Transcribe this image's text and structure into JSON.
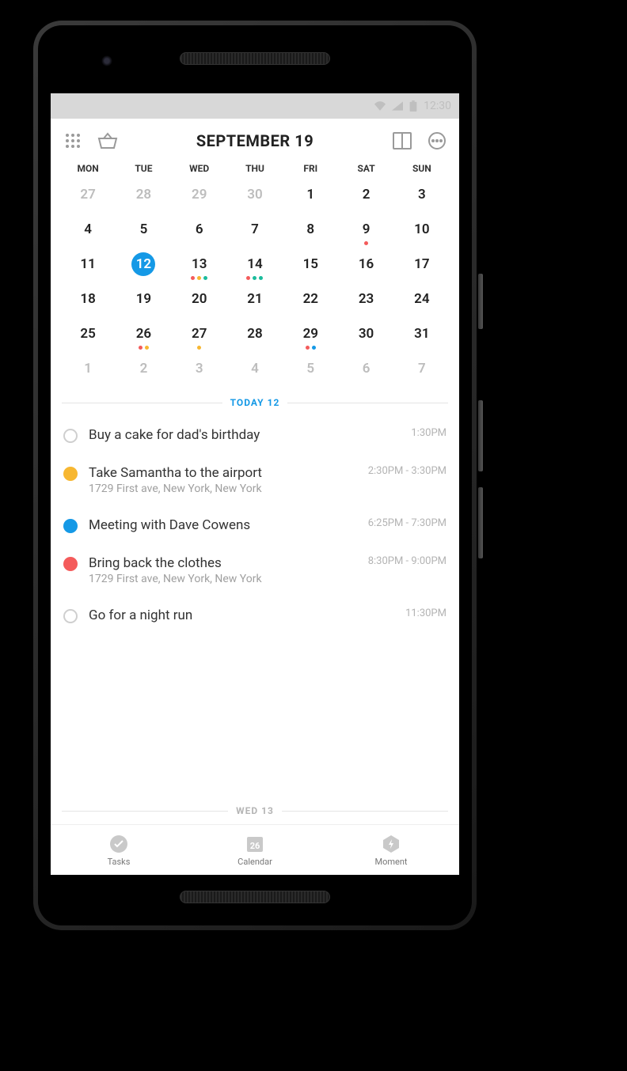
{
  "statusBar": {
    "time": "12:30"
  },
  "header": {
    "title": "SEPTEMBER 19"
  },
  "weekdays": [
    "MON",
    "TUE",
    "WED",
    "THU",
    "FRI",
    "SAT",
    "SUN"
  ],
  "calendar": {
    "selected": 12,
    "weeks": [
      [
        {
          "n": 27,
          "muted": true
        },
        {
          "n": 28,
          "muted": true
        },
        {
          "n": 29,
          "muted": true
        },
        {
          "n": 30,
          "muted": true
        },
        {
          "n": 1
        },
        {
          "n": 2
        },
        {
          "n": 3
        }
      ],
      [
        {
          "n": 4
        },
        {
          "n": 5
        },
        {
          "n": 6
        },
        {
          "n": 7
        },
        {
          "n": 8
        },
        {
          "n": 9,
          "dots": [
            "red"
          ]
        },
        {
          "n": 10
        }
      ],
      [
        {
          "n": 11
        },
        {
          "n": 12,
          "selected": true
        },
        {
          "n": 13,
          "dots": [
            "red",
            "orange",
            "teal"
          ]
        },
        {
          "n": 14,
          "dots": [
            "red",
            "teal",
            "teal"
          ]
        },
        {
          "n": 15
        },
        {
          "n": 16
        },
        {
          "n": 17
        }
      ],
      [
        {
          "n": 18
        },
        {
          "n": 19
        },
        {
          "n": 20
        },
        {
          "n": 21
        },
        {
          "n": 22
        },
        {
          "n": 23
        },
        {
          "n": 24
        }
      ],
      [
        {
          "n": 25
        },
        {
          "n": 26,
          "dots": [
            "red",
            "orange"
          ]
        },
        {
          "n": 27,
          "dots": [
            "orange"
          ]
        },
        {
          "n": 28
        },
        {
          "n": 29,
          "dots": [
            "red",
            "blue"
          ]
        },
        {
          "n": 30
        },
        {
          "n": 31
        }
      ],
      [
        {
          "n": 1,
          "muted": true
        },
        {
          "n": 2,
          "muted": true
        },
        {
          "n": 3,
          "muted": true
        },
        {
          "n": 4,
          "muted": true
        },
        {
          "n": 5,
          "muted": true
        },
        {
          "n": 6,
          "muted": true
        },
        {
          "n": 7,
          "muted": true
        }
      ]
    ]
  },
  "dividers": {
    "today": "TODAY 12",
    "next": "WED 13"
  },
  "tasks": [
    {
      "bullet": "outline",
      "title": "Buy a cake for dad's birthday",
      "time": "1:30PM"
    },
    {
      "bullet": "orange",
      "title": "Take Samantha to the airport",
      "sub": "1729 First ave, New York, New York",
      "time": "2:30PM - 3:30PM"
    },
    {
      "bullet": "blue",
      "title": "Meeting with Dave Cowens",
      "time": "6:25PM - 7:30PM"
    },
    {
      "bullet": "red",
      "title": "Bring back the clothes",
      "sub": "1729 First ave, New York, New York",
      "time": "8:30PM - 9:00PM"
    },
    {
      "bullet": "outline",
      "title": "Go for a night run",
      "time": "11:30PM"
    }
  ],
  "bottomNav": {
    "items": [
      {
        "label": "Tasks"
      },
      {
        "label": "Calendar",
        "badge": "26"
      },
      {
        "label": "Moment"
      }
    ]
  },
  "colors": {
    "accent": "#1599e6",
    "red": "#f45b5b",
    "orange": "#f7b731",
    "teal": "#1abc9c",
    "blue": "#1599e6",
    "mutedText": "#b5b5b5"
  }
}
